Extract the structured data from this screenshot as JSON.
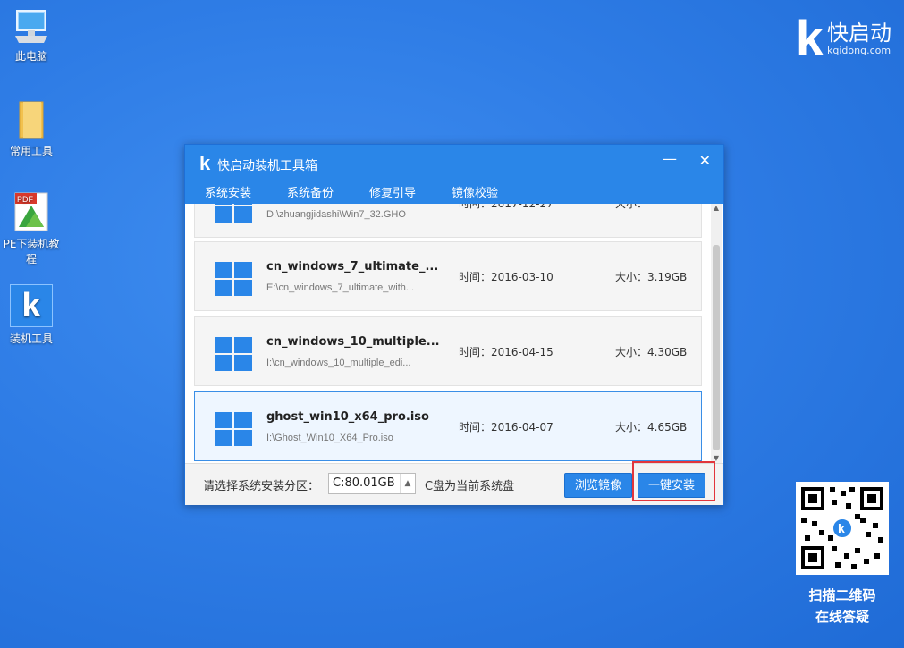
{
  "desktop": {
    "icons": [
      {
        "label": "此电脑",
        "icon": "computer-icon"
      },
      {
        "label": "常用工具",
        "icon": "folder-icon"
      },
      {
        "label": "PE下装机教程",
        "icon": "pdf-icon"
      },
      {
        "label": "装机工具",
        "icon": "k-app-icon"
      }
    ],
    "brand": {
      "name": "快启动",
      "url": "kqidong.com",
      "logo": "k"
    },
    "qr_caption": [
      "扫描二维码",
      "在线答疑"
    ]
  },
  "window": {
    "logo": "k",
    "title": "快启动装机工具箱",
    "controls": {
      "minimize": "—",
      "close": "✕"
    },
    "tabs": [
      {
        "label": "系统安装",
        "active": true
      },
      {
        "label": "系统备份",
        "active": false
      },
      {
        "label": "修复引导",
        "active": false
      },
      {
        "label": "镜像校验",
        "active": false
      }
    ],
    "images": [
      {
        "name": "",
        "path": "D:\\zhuangjidashi\\Win7_32.GHO",
        "time": "时间：2017-12-27",
        "size": "大小：",
        "selected": false
      },
      {
        "name": "cn_windows_7_ultimate_...",
        "path": "E:\\cn_windows_7_ultimate_with...",
        "time": "时间：2016-03-10",
        "size": "大小：3.19GB",
        "selected": false
      },
      {
        "name": "cn_windows_10_multiple...",
        "path": "I:\\cn_windows_10_multiple_edi...",
        "time": "时间：2016-04-15",
        "size": "大小：4.30GB",
        "selected": false
      },
      {
        "name": "ghost_win10_x64_pro.iso",
        "path": "I:\\Ghost_Win10_X64_Pro.iso",
        "time": "时间：2016-04-07",
        "size": "大小：4.65GB",
        "selected": true
      }
    ],
    "footer": {
      "partition_label": "请选择系统安装分区：",
      "partition_value": "C:80.01GB",
      "note": "C盘为当前系统盘",
      "browse_button": "浏览镜像",
      "install_button": "一键安装"
    }
  },
  "colors": {
    "accent": "#2a86e8",
    "highlight": "#e2353b",
    "desktop": "#2f7de6"
  }
}
